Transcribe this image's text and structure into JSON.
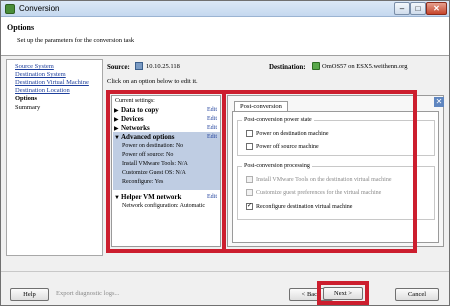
{
  "window": {
    "title": "Conversion"
  },
  "header": {
    "title": "Options",
    "subtitle": "Set up the parameters for the conversion task"
  },
  "nav": {
    "items": [
      {
        "label": "Source System",
        "state": "link"
      },
      {
        "label": "Destination System",
        "state": "link"
      },
      {
        "label": "Destination Virtual Machine",
        "state": "link"
      },
      {
        "label": "Destination Location",
        "state": "link"
      },
      {
        "label": "Options",
        "state": "current"
      },
      {
        "label": "Summary",
        "state": "plain"
      }
    ]
  },
  "source": {
    "label": "Source:",
    "value": "10.10.25.118"
  },
  "destination": {
    "label": "Destination:",
    "value": "OmOS57 on ESX5.weithenn.org"
  },
  "click_hint": "Click on an option below to edit it.",
  "summary": {
    "current_settings": "Current settings:",
    "edit_label": "Edit",
    "sections": [
      {
        "title": "Data to copy"
      },
      {
        "title": "Devices"
      },
      {
        "title": "Networks"
      },
      {
        "title": "Advanced options",
        "details": [
          "Power on destination: No",
          "Power off source: No",
          "Install VMware Tools: N/A",
          "Customize Guest OS: N/A",
          "Reconfigure: Yes"
        ]
      },
      {
        "title": "Helper VM network",
        "details": [
          "Network configuration: Automatic"
        ]
      }
    ]
  },
  "options": {
    "tab": "Post-conversion",
    "power_group": {
      "title": "Post-conversion power state",
      "items": [
        {
          "label": "Power on destination machine",
          "checked": false,
          "enabled": true
        },
        {
          "label": "Power off source machine",
          "checked": false,
          "enabled": true
        }
      ]
    },
    "processing_group": {
      "title": "Post-conversion processing",
      "items": [
        {
          "label": "Install VMware Tools on the destination virtual machine",
          "checked": false,
          "enabled": false
        },
        {
          "label": "Customize guest preferences for the virtual machine",
          "checked": false,
          "enabled": false
        },
        {
          "label": "Reconfigure destination virtual machine",
          "checked": true,
          "enabled": true
        }
      ]
    }
  },
  "footer": {
    "help": "Help",
    "export_logs": "Export diagnostic logs...",
    "back": "< Back",
    "next": "Next >",
    "cancel": "Cancel"
  },
  "colors": {
    "highlight": "#cc1e2e",
    "selection": "#bfcde3",
    "link": "#1e3f9c"
  }
}
